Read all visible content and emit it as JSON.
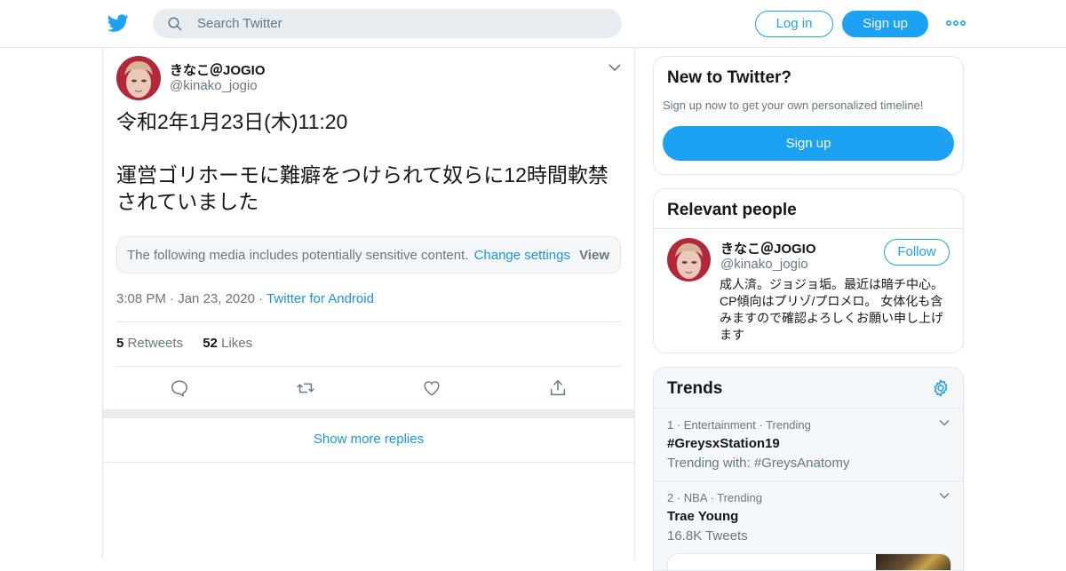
{
  "header": {
    "search_placeholder": "Search Twitter",
    "login_label": "Log in",
    "signup_label": "Sign up",
    "accent_color": "#1da1f2"
  },
  "tweet": {
    "display_name": "きなこ＠JOGIO",
    "handle": "@kinako_jogio",
    "text": "令和2年1月23日(木)11:20\n\n運営ゴリホーモに難癖をつけられて奴らに12時間軟禁されていました",
    "sensitive_notice": "The following media includes potentially sensitive content.",
    "change_settings": "Change settings",
    "view_label": "View",
    "time": "3:08 PM",
    "date": "Jan 23, 2020",
    "source": "Twitter for Android",
    "retweets_count": "5",
    "retweets_label": "Retweets",
    "likes_count": "52",
    "likes_label": "Likes",
    "show_more_replies": "Show more replies"
  },
  "sidebar": {
    "new_to_twitter": {
      "title": "New to Twitter?",
      "subtitle": "Sign up now to get your own personalized timeline!",
      "button": "Sign up"
    },
    "relevant_people": {
      "title": "Relevant people",
      "name": "きなこ＠JOGIO",
      "handle": "@kinako_jogio",
      "follow_label": "Follow",
      "bio": "成人済。ジョジョ垢。最近は暗チ中心。CP傾向はプリゾ/プロメロ。 女体化も含みますので確認よろしくお願い申し上げます"
    },
    "trends": {
      "title": "Trends",
      "items": [
        {
          "rank": "1",
          "category": "Entertainment",
          "status": "Trending",
          "name": "#GreysxStation19",
          "extra": "Trending with: #GreysAnatomy"
        },
        {
          "rank": "2",
          "category": "NBA",
          "status": "Trending",
          "name": "Trae Young",
          "extra": "16.8K Tweets"
        }
      ]
    }
  },
  "icons": [
    "twitter-bird-icon",
    "search-icon",
    "more-icon",
    "chevron-down-icon",
    "reply-icon",
    "retweet-icon",
    "like-icon",
    "share-icon",
    "gear-icon"
  ]
}
